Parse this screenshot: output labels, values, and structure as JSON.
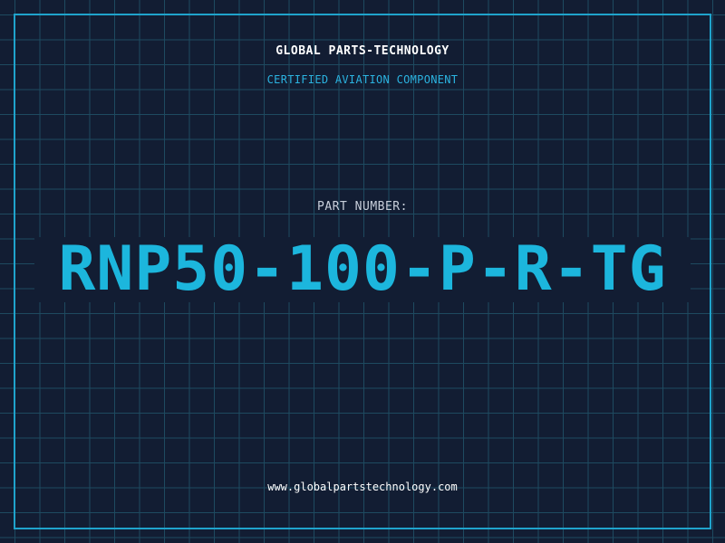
{
  "header": {
    "company_name": "GLOBAL PARTS-TECHNOLOGY",
    "tagline": "CERTIFIED AVIATION COMPONENT"
  },
  "part": {
    "label": "PART NUMBER:",
    "number": "RNP50-100-P-R-TG"
  },
  "footer": {
    "website": "www.globalpartstechnology.com"
  },
  "colors": {
    "background": "#121d33",
    "grid": "#1e4a60",
    "accent": "#1cb6dd",
    "frame": "#1fa3cc",
    "text": "#ffffff"
  }
}
